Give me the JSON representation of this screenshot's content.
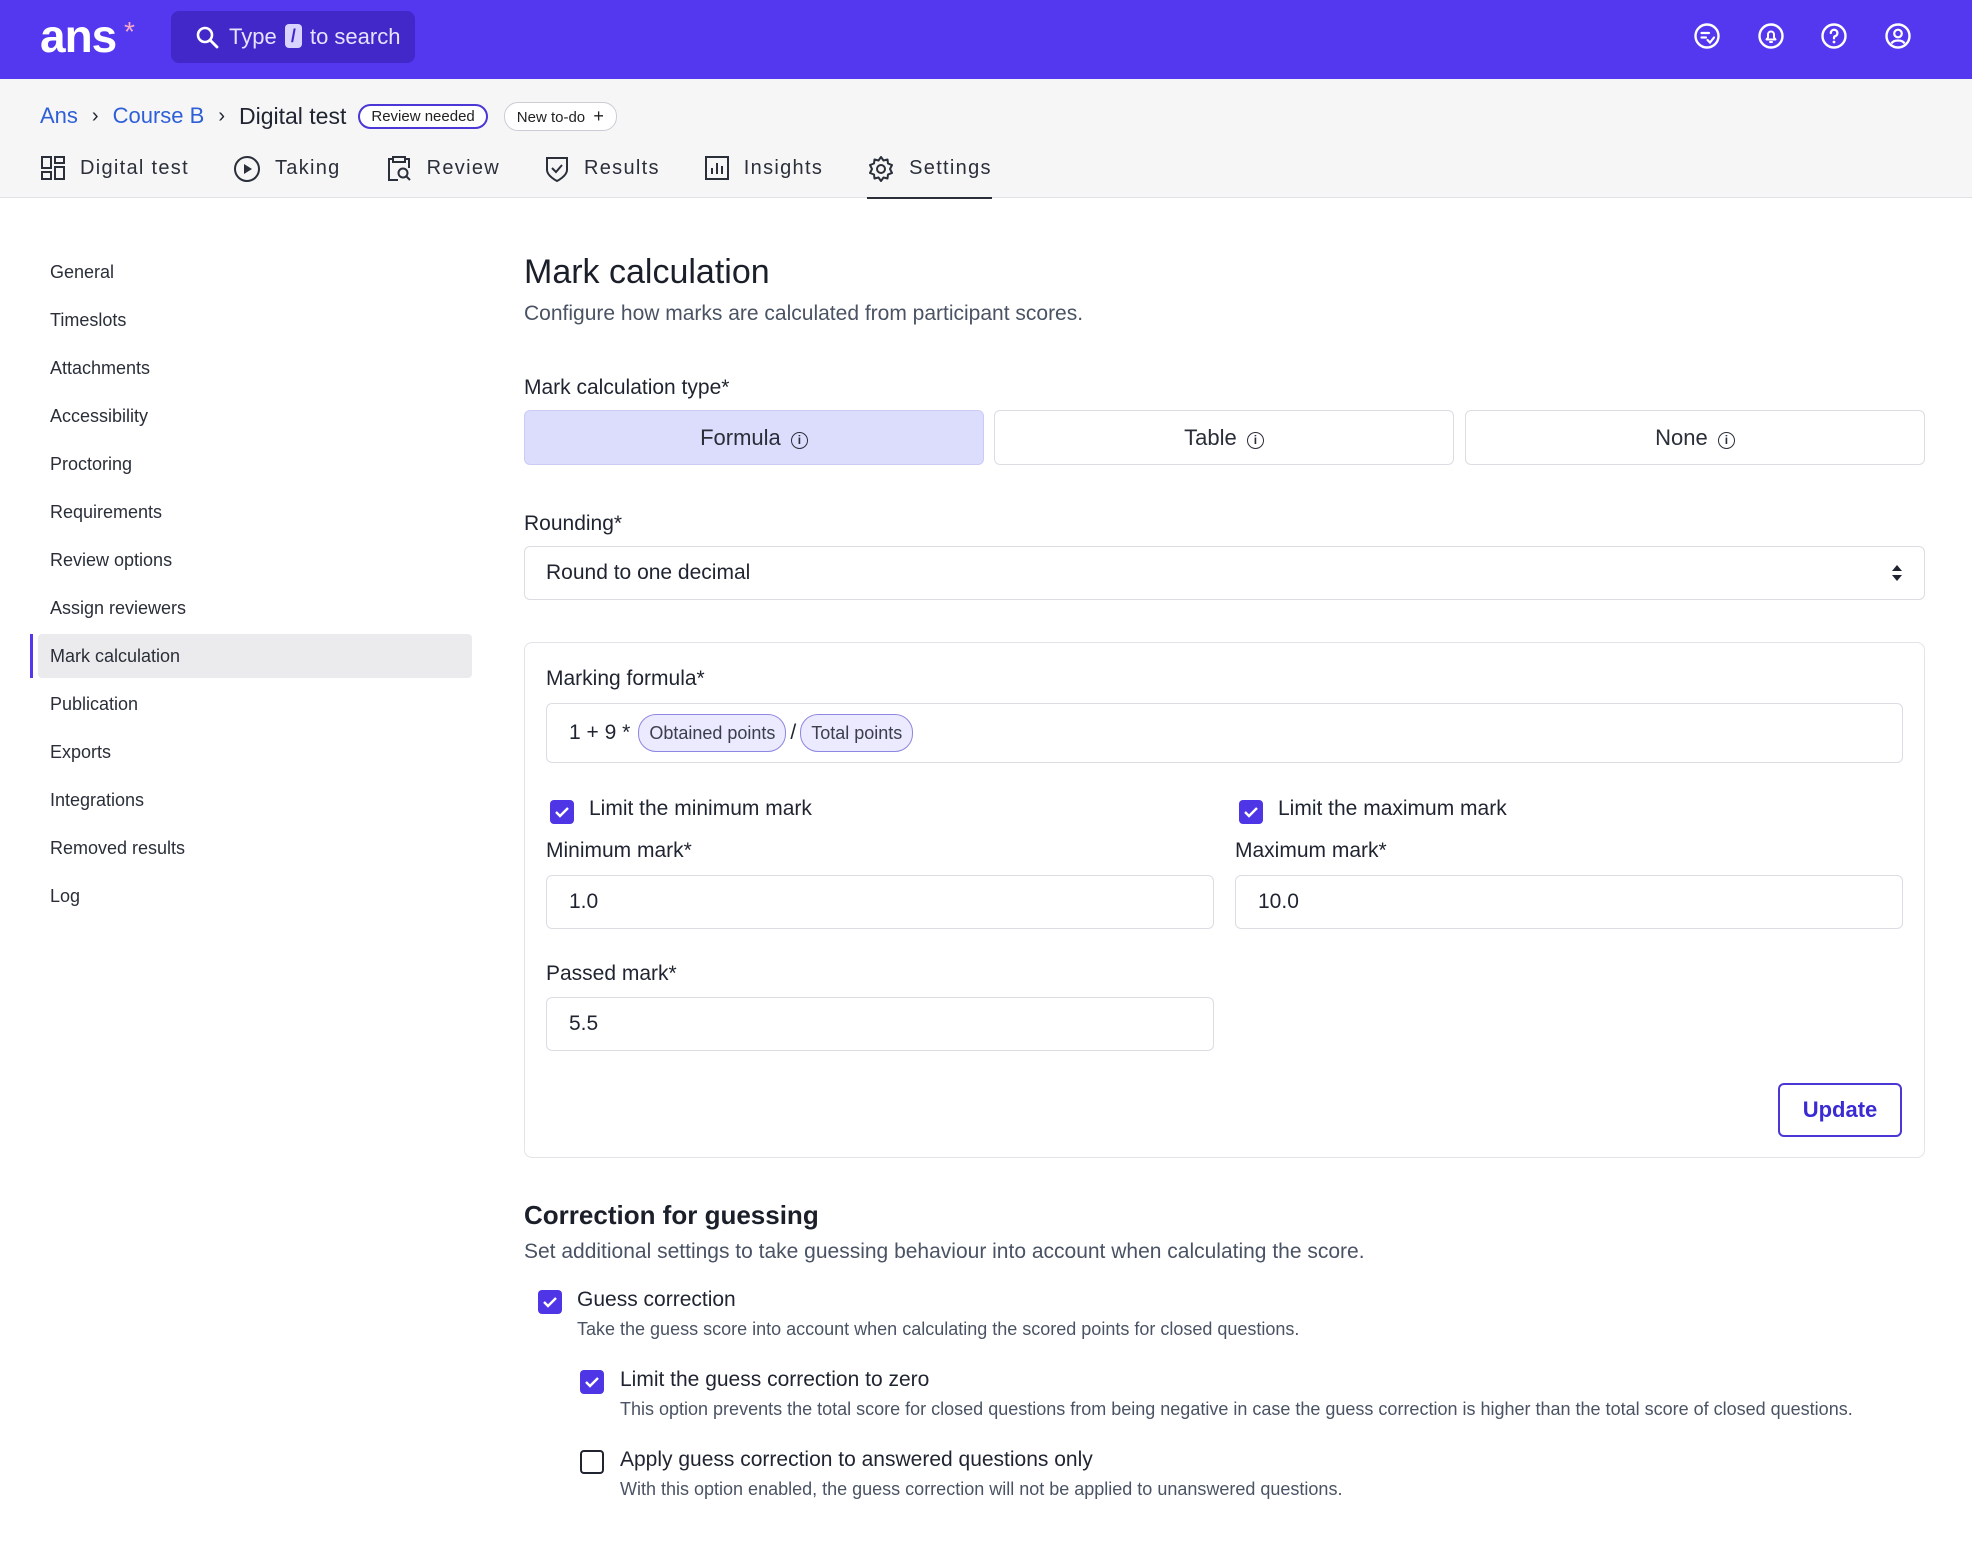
{
  "topbar": {
    "logo": "ans",
    "logo_star": "*",
    "search_prefix": "Type",
    "search_key": "/",
    "search_suffix": "to search",
    "icons": [
      "chat-check-icon",
      "bell-icon",
      "help-icon",
      "user-icon"
    ]
  },
  "breadcrumb": {
    "items": [
      "Ans",
      "Course B"
    ],
    "current": "Digital test",
    "badge": "Review needed",
    "todo": "New to-do"
  },
  "tabs": [
    {
      "label": "Digital test",
      "icon": "grid-icon"
    },
    {
      "label": "Taking",
      "icon": "play-icon"
    },
    {
      "label": "Review",
      "icon": "clipboard-search-icon"
    },
    {
      "label": "Results",
      "icon": "shield-check-icon"
    },
    {
      "label": "Insights",
      "icon": "bar-chart-icon"
    },
    {
      "label": "Settings",
      "icon": "gear-icon",
      "active": true
    }
  ],
  "sidebar": {
    "items": [
      "General",
      "Timeslots",
      "Attachments",
      "Accessibility",
      "Proctoring",
      "Requirements",
      "Review options",
      "Assign reviewers",
      "Mark calculation",
      "Publication",
      "Exports",
      "Integrations",
      "Removed results",
      "Log"
    ],
    "active": "Mark calculation"
  },
  "main": {
    "title": "Mark calculation",
    "subtitle": "Configure how marks are calculated from participant scores.",
    "calc_type_label": "Mark calculation type*",
    "calc_types": [
      "Formula",
      "Table",
      "None"
    ],
    "calc_type_selected": "Formula",
    "rounding_label": "Rounding*",
    "rounding_value": "Round to one decimal",
    "formula_label": "Marking formula*",
    "formula_prefix": "1 + 9 *",
    "formula_var1": "Obtained points",
    "formula_op": "/",
    "formula_var2": "Total points",
    "limit_min_label": "Limit the minimum mark",
    "limit_max_label": "Limit the maximum mark",
    "min_mark_label": "Minimum mark*",
    "min_mark_value": "1.0",
    "max_mark_label": "Maximum mark*",
    "max_mark_value": "10.0",
    "passed_mark_label": "Passed mark*",
    "passed_mark_value": "5.5",
    "update_label": "Update"
  },
  "guessing": {
    "title": "Correction for guessing",
    "subtitle": "Set additional settings to take guessing behaviour into account when calculating the score.",
    "options": [
      {
        "label": "Guess correction",
        "desc": "Take the guess score into account when calculating the scored points for closed questions.",
        "checked": true
      },
      {
        "label": "Limit the guess correction to zero",
        "desc": "This option prevents the total score for closed questions from being negative in case the guess correction is higher than the total score of closed questions.",
        "checked": true
      },
      {
        "label": "Apply guess correction to answered questions only",
        "desc": "With this option enabled, the guess correction will not be applied to unanswered questions.",
        "checked": false
      }
    ]
  },
  "colors": {
    "brand": "#5338f0",
    "accent_checkbox": "#4e35e6",
    "selected_segment": "#dcdcfd"
  }
}
